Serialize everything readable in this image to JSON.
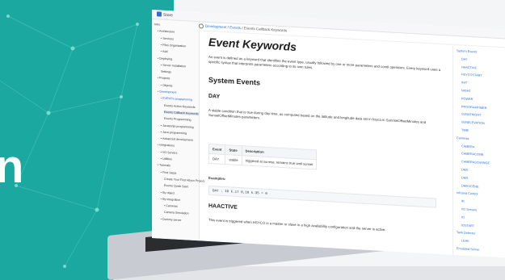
{
  "hero_text": "n",
  "app": {
    "name": "Store"
  },
  "breadcrumb": {
    "part1": "Development",
    "sep": " / ",
    "part2": "Events",
    "current": "Events Callback Keywords"
  },
  "nav": [
    {
      "label": "Intro",
      "indent": 0
    },
    {
      "label": "• Architecture",
      "indent": 1
    },
    {
      "label": "• Services",
      "indent": 2
    },
    {
      "label": "• Files Organization",
      "indent": 2
    },
    {
      "label": "• Add",
      "indent": 2
    },
    {
      "label": "• Deploying",
      "indent": 1
    },
    {
      "label": "• Server Installation",
      "indent": 2
    },
    {
      "label": "Settings",
      "indent": 2
    },
    {
      "label": "• Projects",
      "indent": 1
    },
    {
      "label": "• Objects",
      "indent": 2
    },
    {
      "label": "• Development",
      "indent": 1,
      "active": true
    },
    {
      "label": "• EVENTS programming",
      "indent": 2,
      "active": true
    },
    {
      "label": "Events Action Keywords",
      "indent": 3
    },
    {
      "label": "Events Callback Keywords",
      "indent": 3,
      "selected": true
    },
    {
      "label": "Events Programming",
      "indent": 3
    },
    {
      "label": "• Javascript programming",
      "indent": 2
    },
    {
      "label": "• Java programming",
      "indent": 2
    },
    {
      "label": "• Advanced development",
      "indent": 2
    },
    {
      "label": "• Integrations",
      "indent": 1
    },
    {
      "label": "• I/O Servers",
      "indent": 2
    },
    {
      "label": "• Utilities",
      "indent": 2
    },
    {
      "label": "• Tutorials",
      "indent": 1
    },
    {
      "label": "• First Steps",
      "indent": 2
    },
    {
      "label": "Create Your First Hsyco Project",
      "indent": 3
    },
    {
      "label": "Events Quick Start",
      "indent": 3
    },
    {
      "label": "• By object",
      "indent": 2
    },
    {
      "label": "• By integration",
      "indent": 2
    },
    {
      "label": "• Cameras",
      "indent": 3
    },
    {
      "label": "Camera Simulation",
      "indent": 3
    },
    {
      "label": "• Dummy server",
      "indent": 2
    }
  ],
  "content": {
    "title": "Event Keywords",
    "intro": "An event is defined as a keyword that identifies the event type, usually followed by one or more parameters and condi operators. Every keyword uses a specific syntax that interprets parameters according to its own rules.",
    "h2": "System Events",
    "h3_day": "DAY",
    "day_desc": "A stable condition that is true during day time, as computed based on the latitude and longitude data set in hsyco.in SunriseOffsetMinutes and SunsetOffsetMinutes parameters.",
    "table": {
      "headers": [
        "Event",
        "State",
        "Description"
      ],
      "rows": [
        [
          "DAY",
          "stable",
          "triggered at sunrise; remains true until sunset"
        ]
      ]
    },
    "examples_label": "Examples:",
    "code": "DAY : IO k.17 0,IO k.35 = 0",
    "h3_haactive": "HAACTIVE",
    "haactive_desc": "This event is triggered when HSYCO is a master or slave in a high availability configuration and the server is active."
  },
  "toc": [
    "System Events",
    "DAY",
    "HAACTIVE",
    "HSYCOSTART",
    "INIT",
    "NIGHT",
    "POWER",
    "PROGRAMTIMER",
    "SUNATNIGHT",
    "SUNELEVATION",
    "TIME",
    "Cameras",
    "CAMERA",
    "CAMERACONN",
    "CAMERASCHANGE",
    "DMX",
    "DMX",
    "DMXSCENE",
    "Infrared Control",
    "IR",
    "I/O Servers",
    "IO",
    "IOSTART",
    "Tank Detector",
    "LEAK",
    "Emulated Server",
    "MEMORY"
  ]
}
